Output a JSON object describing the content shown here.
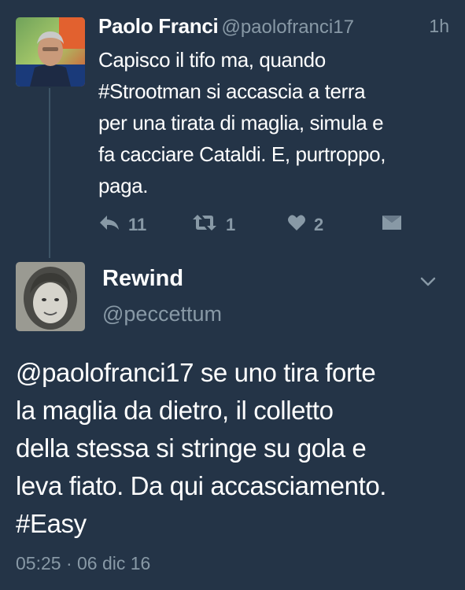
{
  "tweet1": {
    "name": "Paolo Franci",
    "handle": "@paolofranci17",
    "time": "1h",
    "text_lines": [
      "Capisco il tifo ma,  quando",
      "#Strootman si accascia a terra",
      "per una tirata di maglia, simula e",
      "fa cacciare Cataldi. E, purtroppo,",
      "paga."
    ],
    "actions": {
      "reply_count": "11",
      "retweet_count": "1",
      "like_count": "2"
    }
  },
  "tweet2": {
    "name": "Rewind",
    "handle": "@peccettum",
    "text_lines": [
      "@paolofranci17 se uno tira forte",
      "la maglia da dietro, il colletto",
      "della stessa si stringe su gola e",
      "leva fiato. Da qui accasciamento.",
      "#Easy"
    ],
    "timestamp": "05:25 · 06 dic 16"
  },
  "colors": {
    "background": "#243447",
    "secondary_text": "#8899a6",
    "primary_text": "#ffffff",
    "thread_line": "#3d5466"
  },
  "icons": [
    "reply-icon",
    "retweet-icon",
    "like-icon",
    "direct-message-icon",
    "caret-down-icon"
  ]
}
